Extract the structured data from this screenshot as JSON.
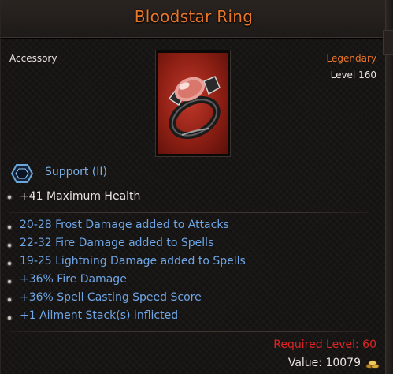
{
  "item": {
    "name": "Bloodstar Ring",
    "type": "Accessory",
    "rarity": "Legendary",
    "level": "Level 160",
    "rarity_color": "#e8762b"
  },
  "support": {
    "label": "Support (II)",
    "icon": "hexagon-gem-icon"
  },
  "base_stats": [
    "+41 Maximum Health"
  ],
  "affixes": [
    "20-28 Frost Damage added to Attacks",
    "22-32 Fire Damage added to Spells",
    "19-25 Lightning Damage added to Spells",
    "+36% Fire Damage",
    "+36% Spell Casting Speed Score",
    "+1 Ailment Stack(s) inflicted"
  ],
  "requirements": {
    "required_level": "Required Level: 60",
    "value": "Value: 10079",
    "currency_icon": "gold-coins-icon"
  }
}
